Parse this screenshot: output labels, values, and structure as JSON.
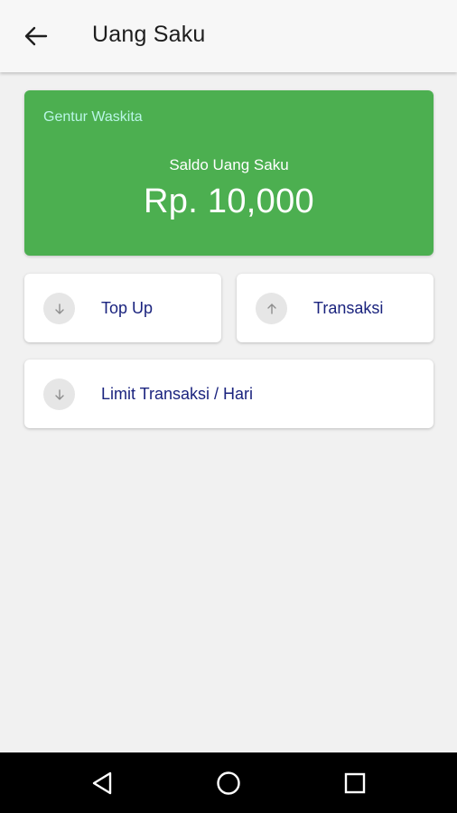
{
  "appbar": {
    "title": "Uang Saku",
    "back_icon": "arrow-left-icon"
  },
  "balance": {
    "owner_name": "Gentur Waskita",
    "label": "Saldo Uang Saku",
    "amount": "Rp. 10,000",
    "background_color": "#4caf50"
  },
  "actions": [
    {
      "label": "Top Up",
      "icon": "arrow-down-icon"
    },
    {
      "label": "Transaksi",
      "icon": "arrow-up-icon"
    },
    {
      "label": "Limit Transaksi / Hari",
      "icon": "arrow-down-icon"
    }
  ],
  "navigation": {
    "back_icon": "triangle-back-icon",
    "home_icon": "circle-home-icon",
    "recent_icon": "square-recents-icon"
  },
  "colors": {
    "accent_text": "#1a237e",
    "owner_text": "#b9f6e6"
  }
}
